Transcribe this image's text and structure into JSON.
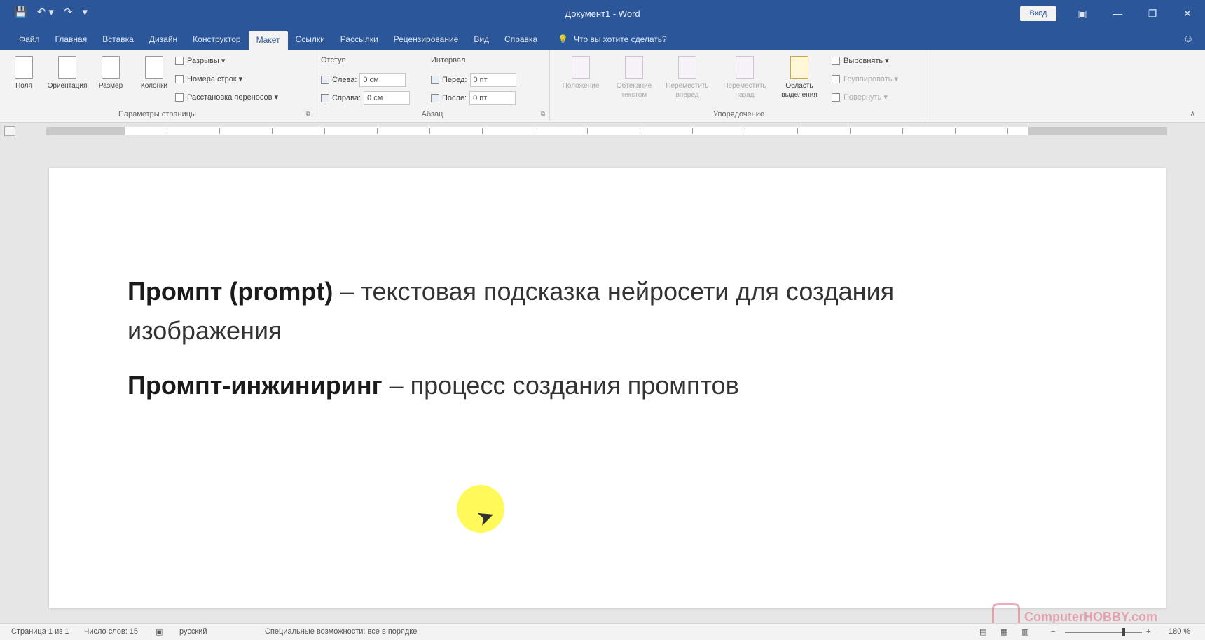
{
  "window": {
    "title": "Документ1 - Word",
    "signin_label": "Вход",
    "win_buttons": [
      "▣",
      "—",
      "❐",
      "✕"
    ]
  },
  "qat": [
    "💾",
    "↶ ▾",
    "↷",
    "▾"
  ],
  "tabs": [
    "Файл",
    "Главная",
    "Вставка",
    "Дизайн",
    "Конструктор",
    "Макет",
    "Ссылки",
    "Рассылки",
    "Рецензирование",
    "Вид",
    "Справка"
  ],
  "active_tab": "Макет",
  "tell_me": "Что вы хотите сделать?",
  "ribbon": {
    "page_setup": {
      "label": "Параметры страницы",
      "buttons": [
        "Поля",
        "Ориентация",
        "Размер",
        "Колонки"
      ],
      "small": [
        "Разрывы ▾",
        "Номера строк ▾",
        "Расстановка переносов ▾"
      ]
    },
    "paragraph": {
      "label": "Абзац",
      "indent_head": "Отступ",
      "spacing_head": "Интервал",
      "left_label": "Слева:",
      "right_label": "Справа:",
      "before_label": "Перед:",
      "after_label": "После:",
      "left_value": "0 см",
      "right_value": "0 см",
      "before_value": "0 пт",
      "after_value": "0 пт"
    },
    "arrange": {
      "label": "Упорядочение",
      "buttons": [
        "Положение",
        "Обтекание текстом",
        "Переместить вперед",
        "Переместить назад",
        "Область выделения"
      ],
      "small": [
        "Выровнять ▾",
        "Группировать ▾",
        "Повернуть ▾"
      ]
    }
  },
  "document": {
    "para1_bold": "Промпт (prompt)",
    "para1_text": " – текстовая подсказка нейросети для создания изображения",
    "para2_bold": "Промпт-инжиниринг",
    "para2_text": " – процесс создания промптов"
  },
  "statusbar": {
    "page": "Страница 1 из 1",
    "words": "Число слов: 15",
    "lang": "русский",
    "accessibility": "Специальные возможности: все в порядке",
    "zoom": "180 %"
  },
  "watermark": "ComputerHOBBY.com"
}
